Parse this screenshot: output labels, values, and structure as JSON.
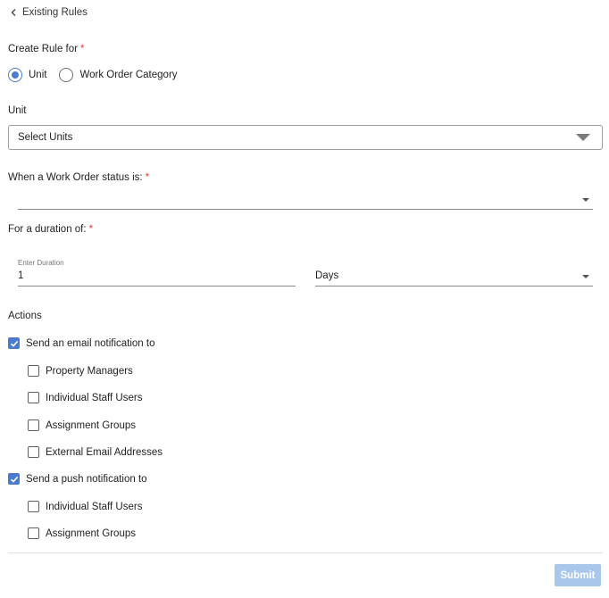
{
  "header": {
    "back_label": "Existing Rules"
  },
  "create_rule": {
    "label": "Create Rule for",
    "required_mark": "*",
    "options": [
      {
        "label": "Unit",
        "checked": true
      },
      {
        "label": "Work Order Category",
        "checked": false
      }
    ]
  },
  "unit": {
    "label": "Unit",
    "select_value": "Select Units"
  },
  "status": {
    "label": "When a Work Order status is:",
    "required_mark": "*",
    "value": ""
  },
  "duration": {
    "label": "For a duration of:",
    "required_mark": "*",
    "input_label": "Enter Duration",
    "input_value": "1",
    "unit_value": "Days"
  },
  "actions": {
    "label": "Actions",
    "email": {
      "label": "Send an email notification to",
      "checked": true,
      "items": [
        {
          "label": "Property Managers",
          "checked": false
        },
        {
          "label": "Individual Staff Users",
          "checked": false
        },
        {
          "label": "Assignment Groups",
          "checked": false
        },
        {
          "label": "External Email Addresses",
          "checked": false
        }
      ]
    },
    "push": {
      "label": "Send a push notification to",
      "checked": true,
      "items": [
        {
          "label": "Individual Staff Users",
          "checked": false
        },
        {
          "label": "Assignment Groups",
          "checked": false
        }
      ]
    }
  },
  "footer": {
    "submit_label": "Submit"
  },
  "colors": {
    "accent": "#4a7bd0",
    "required": "#e53935",
    "submit_disabled": "#a9c6ec"
  }
}
